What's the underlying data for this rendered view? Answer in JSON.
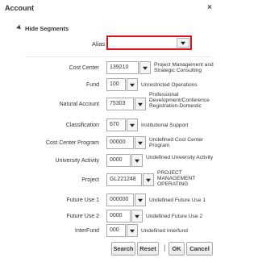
{
  "dialog": {
    "title": "Account",
    "close_icon": "×"
  },
  "segments_toggle": {
    "label": "Hide Segments"
  },
  "alias": {
    "label": "Alias",
    "value": ""
  },
  "fields": [
    {
      "key": "cost_center",
      "label": "Cost Center",
      "value": "139210",
      "description": "Project Management and Strategic Consulting"
    },
    {
      "key": "fund",
      "label": "Fund",
      "value": "100",
      "description": "Unrestricted Operations"
    },
    {
      "key": "natural_account",
      "label": "Natural Account",
      "value": "75303",
      "description": "Professional Development/Conference Registration-Domestic"
    },
    {
      "key": "classification",
      "label": "Classification",
      "value": "670",
      "description": "Institutional Support"
    },
    {
      "key": "cost_center_program",
      "label": "Cost Center Program",
      "value": "00000",
      "description": "Undefined Cost Center Program"
    },
    {
      "key": "university_activity",
      "label": "University Activity",
      "value": "0000",
      "description": "Undefined University Activity"
    },
    {
      "key": "project",
      "label": "Project",
      "value": "GL221248",
      "description": "PROJECT MANAGEMENT OPERATING"
    },
    {
      "key": "future_use_1",
      "label": "Future Use 1",
      "value": "000000",
      "description": "Undefined Future Use 1"
    },
    {
      "key": "future_use_2",
      "label": "Future Use 2",
      "value": "0000",
      "description": "Undefined Future Use 2"
    },
    {
      "key": "interfund",
      "label": "InterFund",
      "value": "000",
      "description": "Undefined Interfund"
    }
  ],
  "buttons": {
    "search": "Search",
    "reset": "Reset",
    "separator": "|",
    "ok": "OK",
    "cancel": "Cancel"
  }
}
